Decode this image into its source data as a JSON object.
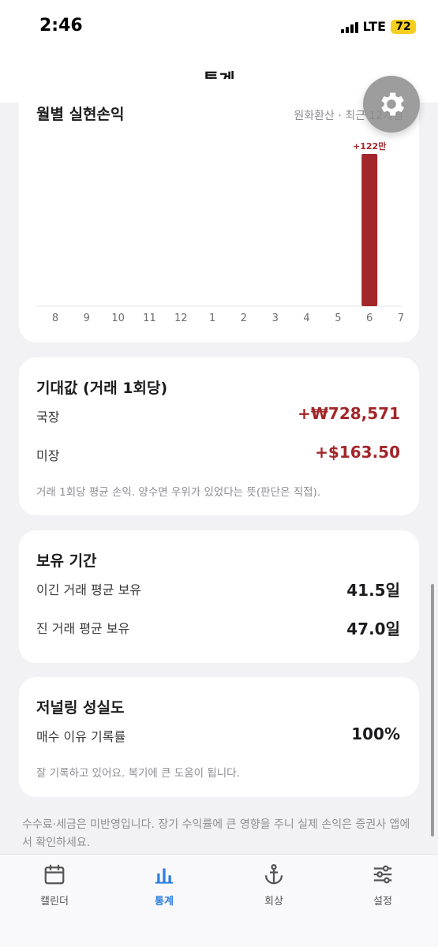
{
  "status": {
    "time": "2:46",
    "network": "LTE",
    "battery": "72"
  },
  "header": {
    "title": "통계"
  },
  "chart_card": {
    "title": "월별 실현손익",
    "subtitle": "원화환산 · 최근 12개월"
  },
  "chart_data": {
    "type": "bar",
    "title": "월별 실현손익",
    "categories": [
      "8",
      "9",
      "10",
      "11",
      "12",
      "1",
      "2",
      "3",
      "4",
      "5",
      "6",
      "7"
    ],
    "values": [
      0,
      0,
      0,
      0,
      0,
      0,
      0,
      0,
      0,
      0,
      1220000,
      0
    ],
    "data_labels": [
      "",
      "",
      "",
      "",
      "",
      "",
      "",
      "",
      "",
      "",
      "+122만",
      ""
    ],
    "ylim": [
      0,
      1220000
    ],
    "bar_color": "#a3262a",
    "grid": false
  },
  "expected": {
    "title": "기대값 (거래 1회당)",
    "rows": [
      {
        "label": "국장",
        "value": "+₩728,571"
      },
      {
        "label": "미장",
        "value": "+$163.50"
      }
    ],
    "note": "거래 1회당 평균 손익. 양수면 우위가 있었다는 뜻(판단은 직접)."
  },
  "holding": {
    "title": "보유 기간",
    "rows": [
      {
        "label": "이긴 거래 평균 보유",
        "value": "41.5일"
      },
      {
        "label": "진 거래 평균 보유",
        "value": "47.0일"
      }
    ]
  },
  "journal": {
    "title": "저널링 성실도",
    "rows": [
      {
        "label": "매수 이유 기록률",
        "value": "100%"
      }
    ],
    "note": "잘 기록하고 있어요. 복기에 큰 도움이 됩니다."
  },
  "footer": {
    "note": "수수료·세금은 미반영입니다. 장기 수익률에 큰 영향을 주니 실제 손익은 증권사 앱에서 확인하세요."
  },
  "tabs": [
    {
      "label": "캘린더",
      "icon": "calendar-icon"
    },
    {
      "label": "통계",
      "icon": "bar-chart-icon",
      "active": true
    },
    {
      "label": "회상",
      "icon": "anchor-icon"
    },
    {
      "label": "설정",
      "icon": "sliders-icon"
    }
  ],
  "colors": {
    "accent": "#2b7de0",
    "profit": "#a3262a",
    "battery": "#f6cf1e"
  }
}
